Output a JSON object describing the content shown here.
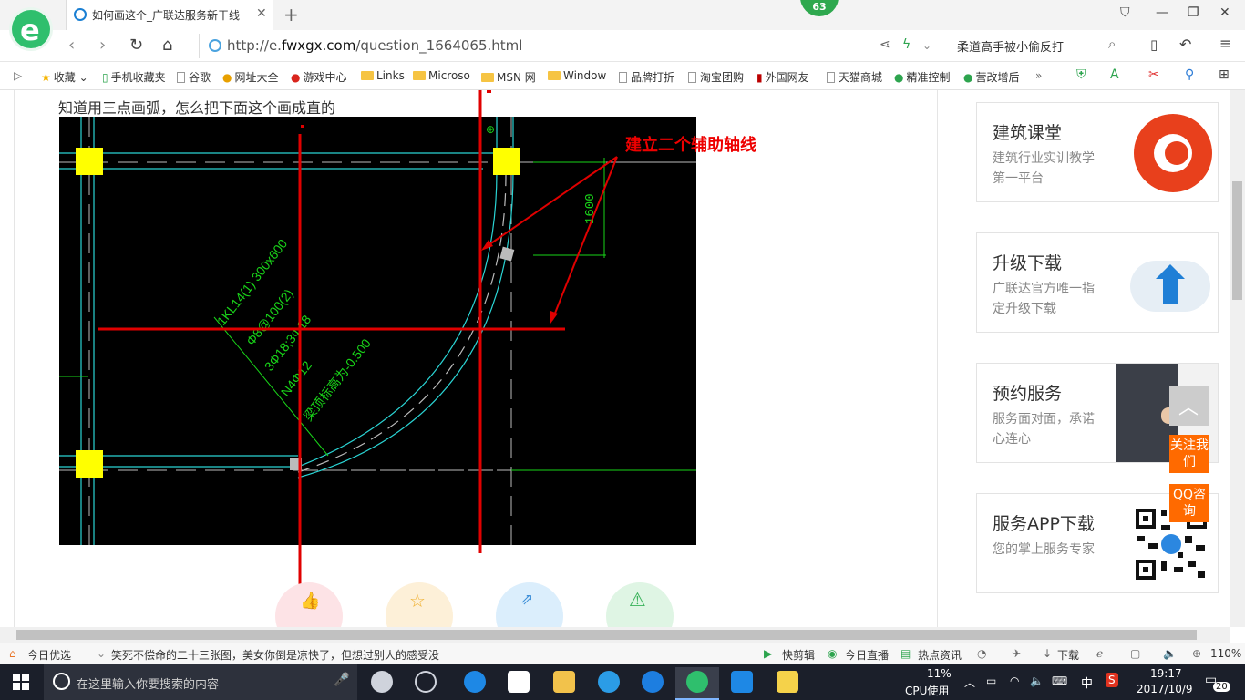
{
  "browser": {
    "tab_title": "如何画这个_广联达服务新干线",
    "badge": "63",
    "url_scheme": "http://e.",
    "url_domain": "fwxgx.com",
    "url_path": "/question_1664065.html",
    "search_text": "柔道高手被小偷反打"
  },
  "bookmarks": [
    {
      "label": "收藏",
      "kind": "star"
    },
    {
      "label": "手机收藏夹",
      "kind": "phone"
    },
    {
      "label": "谷歌",
      "kind": "page"
    },
    {
      "label": "网址大全",
      "kind": "globe"
    },
    {
      "label": "游戏中心",
      "kind": "game"
    },
    {
      "label": "Links",
      "kind": "folder"
    },
    {
      "label": "Microso",
      "kind": "folder"
    },
    {
      "label": "MSN 网",
      "kind": "folder"
    },
    {
      "label": "Window",
      "kind": "folder"
    },
    {
      "label": "品牌打折",
      "kind": "page"
    },
    {
      "label": "淘宝团购",
      "kind": "page"
    },
    {
      "label": "外国网友",
      "kind": "page"
    },
    {
      "label": "天猫商城",
      "kind": "page"
    },
    {
      "label": "精准控制",
      "kind": "wechat"
    },
    {
      "label": "营改增后",
      "kind": "wechat"
    }
  ],
  "question": {
    "title": "知道用三点画弧，怎么把下面这个画成直的",
    "annotation": "建立二个辅助轴线"
  },
  "cad_text": {
    "dim": "1600",
    "line1": "1KL14(1) 300x600",
    "line2": "Φ8@100(2)",
    "line3": "3Φ18;3Φ18",
    "line4": "N4Φ12",
    "line5": "梁顶标高为-0.500"
  },
  "sidebar_cards": [
    {
      "title": "建筑课堂",
      "desc": "建筑行业实训教学第一平台"
    },
    {
      "title": "升级下载",
      "desc": "广联达官方唯一指定升级下载"
    },
    {
      "title": "预约服务",
      "desc": "服务面对面，承诺心连心"
    },
    {
      "title": "服务APP下载",
      "desc": "您的掌上服务专家"
    }
  ],
  "float_buttons": {
    "follow": "关注我们",
    "qq": "QQ咨询"
  },
  "status_bar": {
    "today": "今日优选",
    "news": "笑死不偿命的二十三张图，美女你倒是凉快了，但想过别人的感受没",
    "kuaijianji": "快剪辑",
    "live": "今日直播",
    "hot": "热点资讯",
    "download": "下载",
    "zoom": "110%"
  },
  "taskbar": {
    "search_placeholder": "在这里输入你要搜索的内容",
    "cpu_percent": "11%",
    "cpu_label": "CPU使用",
    "ime": "中",
    "time": "19:17",
    "date": "2017/10/9",
    "notifications": "20"
  },
  "colors": {
    "cad_line": "#2ad4d4",
    "cad_text": "#19d419",
    "annotation": "#e00000",
    "accent": "#ff6a00"
  }
}
